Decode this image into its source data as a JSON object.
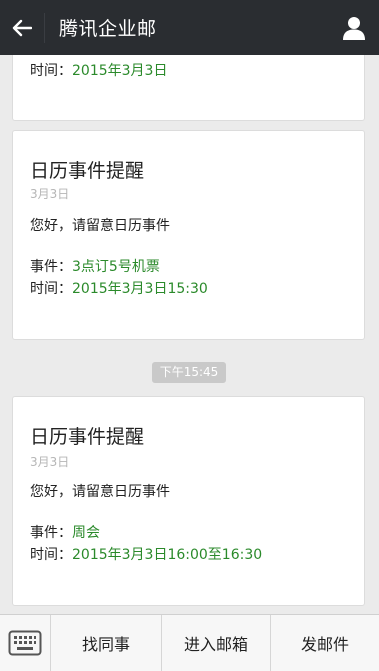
{
  "header": {
    "title": "腾讯企业邮",
    "back_icon": "back-arrow-icon",
    "profile_icon": "person-icon"
  },
  "messages": [
    {
      "time_label": "时间：",
      "time_value": "2015年3月3日"
    },
    {
      "title": "日历事件提醒",
      "date": "3月3日",
      "greeting": "您好，请留意日历事件",
      "event_label": "事件：",
      "event_value": "3点订5号机票",
      "time_label": "时间：",
      "time_value": "2015年3月3日15:30"
    },
    {
      "title": "日历事件提醒",
      "date": "3月3日",
      "greeting": "您好，请留意日历事件",
      "event_label": "事件：",
      "event_value": "周会",
      "time_label": "时间：",
      "time_value": "2015年3月3日16:00至16:30"
    }
  ],
  "timestamp": "下午15:45",
  "bottom": {
    "keyboard_icon": "keyboard-icon",
    "tabs": [
      "找同事",
      "进入邮箱",
      "发邮件"
    ]
  },
  "colors": {
    "header_bg": "#2a2d31",
    "value_green": "#2b8a2b",
    "page_bg": "#ebebeb"
  }
}
